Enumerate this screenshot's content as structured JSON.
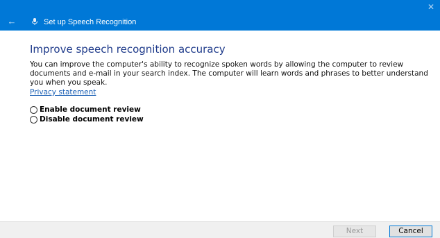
{
  "window": {
    "title": "Set up Speech Recognition",
    "close_glyph": "✕",
    "back_glyph": "←",
    "accent": "#0078d7"
  },
  "content": {
    "heading": "Improve speech recognition accuracy",
    "description": "You can improve the computer's ability to recognize spoken words by allowing the computer to review documents and e-mail in your search index. The computer will learn words and phrases to better understand you when you speak.",
    "privacy_link": "Privacy statement",
    "options": [
      {
        "label": "Enable document review",
        "selected": false
      },
      {
        "label": "Disable document review",
        "selected": false
      }
    ]
  },
  "footer": {
    "next_label": "Next",
    "cancel_label": "Cancel"
  },
  "icons": {
    "back": "back-arrow-icon",
    "app": "microphone-icon",
    "close": "close-icon"
  }
}
